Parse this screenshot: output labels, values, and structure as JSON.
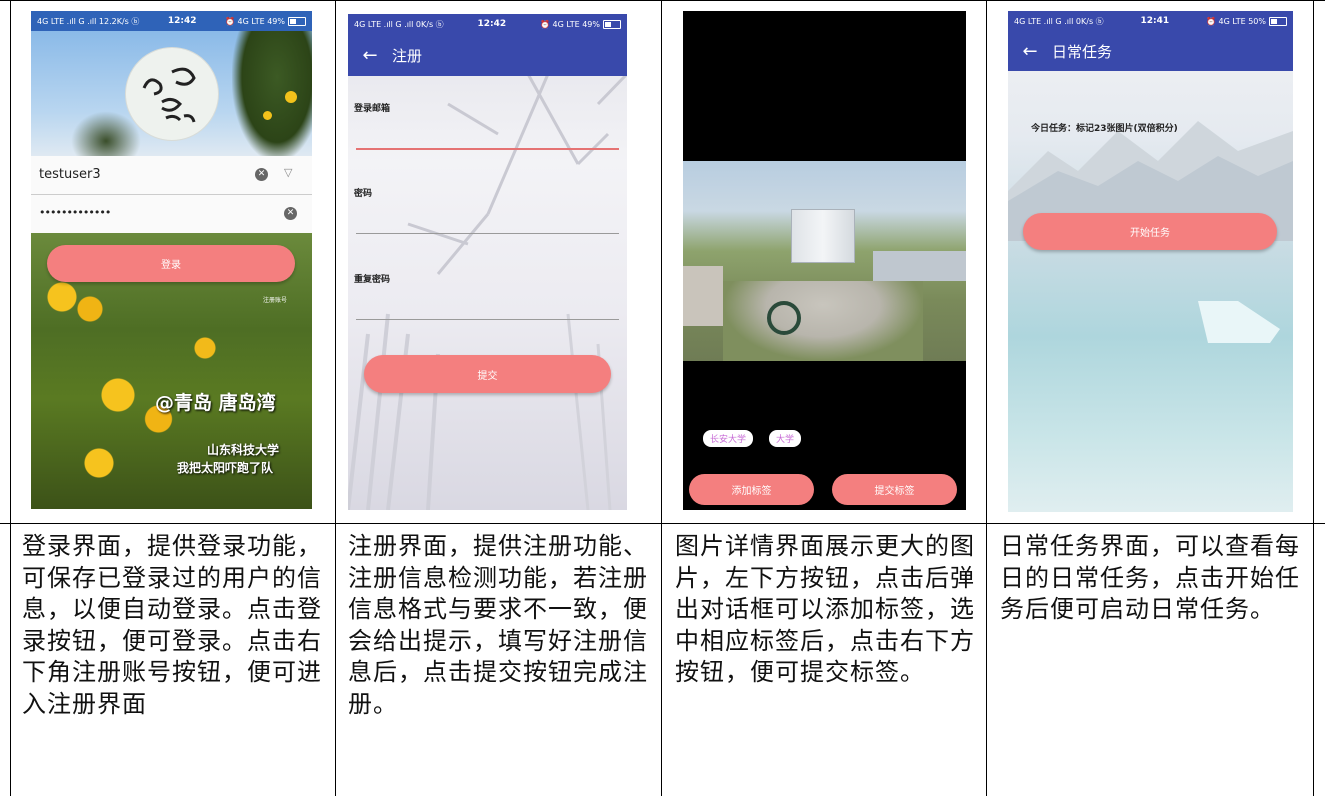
{
  "login": {
    "status": {
      "left": "4G LTE .ıll G .ıll 12.2K/s ⓑ",
      "time": "12:42",
      "right": "⏰ 4G LTE 49%"
    },
    "username": "testuser3",
    "password": "•••••••••••••",
    "login_button": "登录",
    "register_link": "注册账号",
    "photo_caption": "@青岛 唐岛湾",
    "photo_sub1": "山东科技大学",
    "photo_sub2": "我把太阳吓跑了队"
  },
  "register": {
    "status": {
      "left": "4G LTE .ıll G .ıll 0K/s ⓑ",
      "time": "12:42",
      "right": "⏰ 4G LTE 49%"
    },
    "title": "注册",
    "email_label": "登录邮箱",
    "password_label": "密码",
    "repeat_label": "重复密码",
    "submit_button": "提交"
  },
  "detail": {
    "tag1": "长安大学",
    "tag2": "大学",
    "add_tag_button": "添加标签",
    "submit_tag_button": "提交标签"
  },
  "daily": {
    "status": {
      "left": "4G LTE .ıll G .ıll 0K/s ⓑ",
      "time": "12:41",
      "right": "⏰ 4G LTE 50%"
    },
    "title": "日常任务",
    "task_text": "今日任务：标记23张图片(双倍积分)",
    "start_button": "开始任务"
  },
  "descriptions": {
    "login": "登录界面，提供登录功能，可保存已登录过的用户的信息，以便自动登录。点击登录按钮，便可登录。点击右下角注册账号按钮，便可进入注册界面",
    "register": "注册界面，提供注册功能、注册信息检测功能，若注册信息格式与要求不一致，便会给出提示，填写好注册信息后，点击提交按钮完成注册。",
    "detail": "图片详情界面展示更大的图片，左下方按钮，点击后弹出对话框可以添加标签，选中相应标签后，点击右下方按钮，便可提交标签。",
    "daily": "日常任务界面，可以查看每日的日常任务，点击开始任务后便可启动日常任务。"
  },
  "colors": {
    "app_bar": "#3949ab",
    "button": "#f47f7f",
    "focus_line": "#e57373"
  }
}
